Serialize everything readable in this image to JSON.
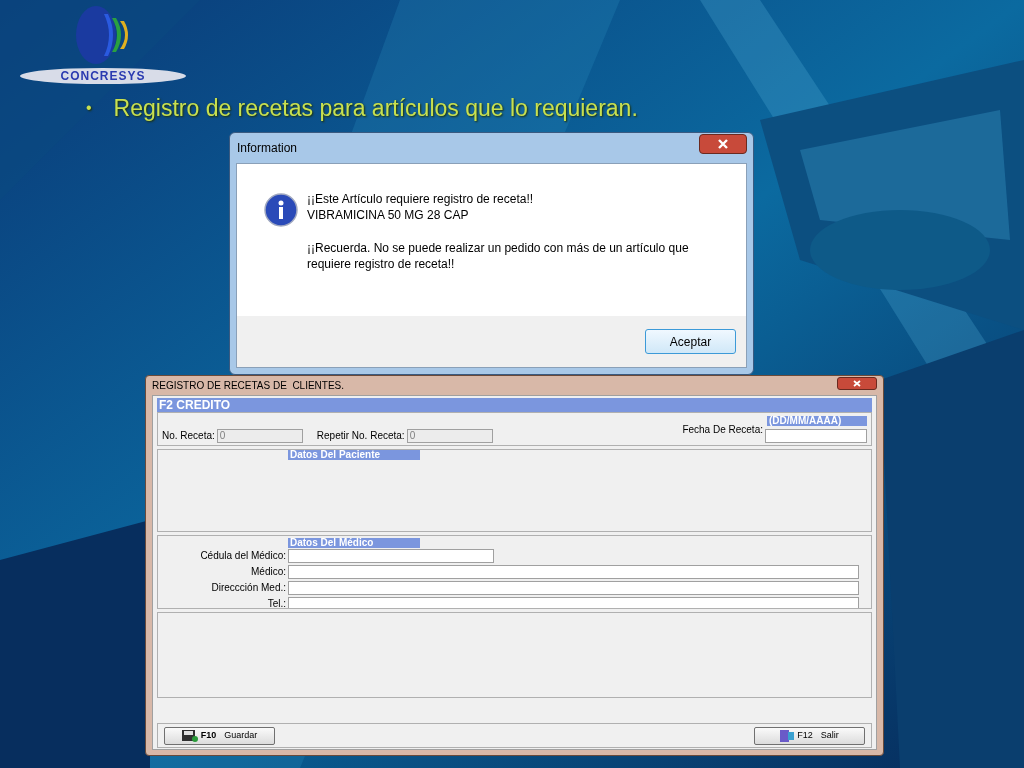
{
  "logo": {
    "text": "CONCRESYS"
  },
  "bullet": {
    "marker": "•",
    "text": "Registro de recetas para artículos que lo requieran."
  },
  "dialog": {
    "title": "Information",
    "paragraphs": [
      [
        "¡¡Este Artículo requiere registro de receta!!",
        "VIBRAMICINA 50 MG 28 CAP"
      ],
      [
        "¡¡Recuerda. No se puede realizar un pedido con más de un artículo que requiere registro de receta!!"
      ]
    ],
    "button": "Aceptar"
  },
  "form": {
    "title": "REGISTRO DE RECETAS DE  CLIENTES.",
    "header": "F2 CREDITO",
    "date_hint": "(DD/MM/AAAA)",
    "top_fields": [
      {
        "label": "No. Receta:",
        "value": "0",
        "disabled": true
      },
      {
        "label": "Repetir No. Receta:",
        "value": "0",
        "disabled": true
      },
      {
        "label": "Fecha De Receta:",
        "disabled": false
      }
    ],
    "patient_section": "Datos Del Paciente",
    "doctor_section": "Datos Del Médico",
    "doctor_fields": [
      {
        "label": "Cédula del Médico:",
        "kind": "short"
      },
      {
        "label": "Médico:",
        "kind": "long"
      },
      {
        "label": "Direccción Med.:",
        "kind": "long"
      },
      {
        "label": "Tel.:",
        "kind": "long"
      }
    ],
    "buttons": [
      {
        "key": "F10",
        "label": "Guardar",
        "kind": "save"
      },
      {
        "key": "F12",
        "label": "Salir",
        "kind": "exit"
      }
    ]
  }
}
